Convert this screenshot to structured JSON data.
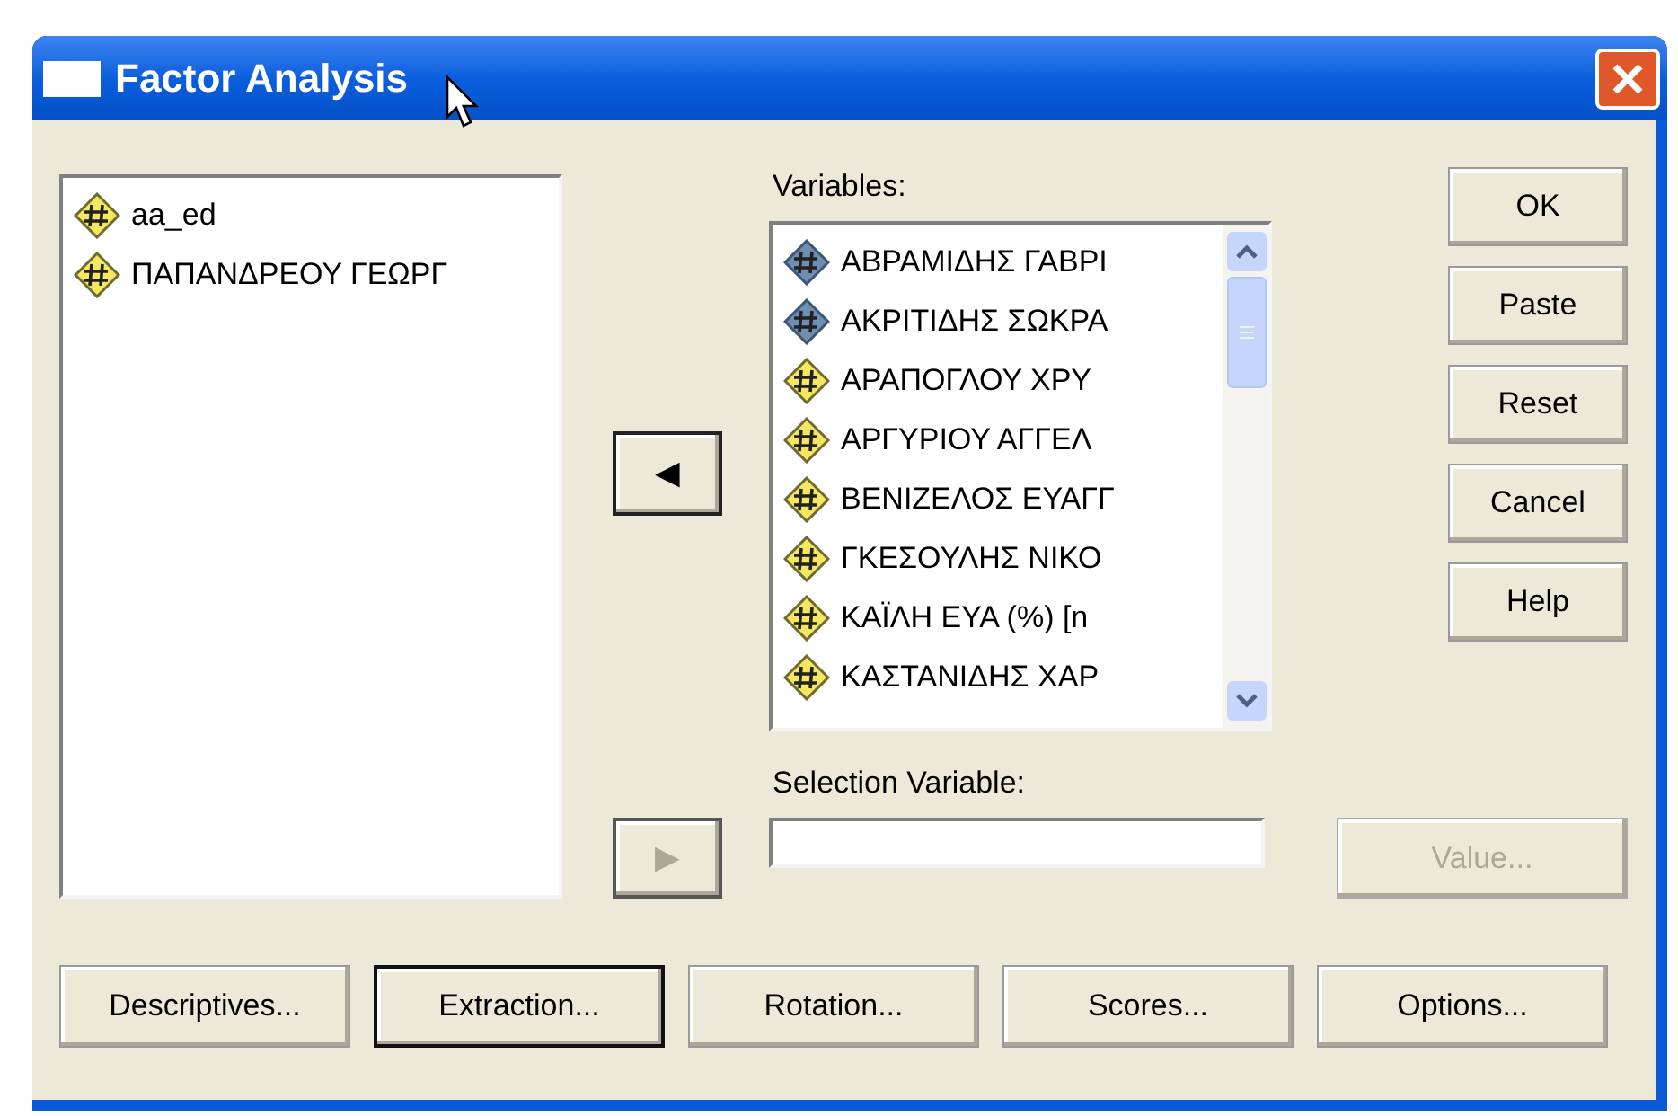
{
  "window": {
    "title": "Factor Analysis"
  },
  "source_list": {
    "items": [
      {
        "label": "aa_ed",
        "selected": false
      },
      {
        "label": "ΠΑΠΑΝΔΡΕΟΥ ΓΕΩΡΓ",
        "selected": false
      }
    ]
  },
  "move_button": {
    "label": "◀",
    "disabled": false
  },
  "variables": {
    "label": "Variables:",
    "items": [
      {
        "label": "ΑΒΡΑΜΙΔΗΣ ΓΑΒΡΙ",
        "selected": true
      },
      {
        "label": "ΑΚΡΙΤΙΔΗΣ ΣΩΚΡΑ",
        "selected": true
      },
      {
        "label": "ΑΡΑΠΟΓΛΟΥ ΧΡΥ",
        "selected": false
      },
      {
        "label": "ΑΡΓΥΡΙΟΥ ΑΓΓΕΛ",
        "selected": false
      },
      {
        "label": "ΒΕΝΙΖΕΛΟΣ ΕΥΑΓΓ",
        "selected": false
      },
      {
        "label": "ΓΚΕΣΟΥΛΗΣ ΝΙΚΟ",
        "selected": false
      },
      {
        "label": "ΚΑΪΛΗ ΕΥΑ (%) [n",
        "selected": false
      },
      {
        "label": "ΚΑΣΤΑΝΙΔΗΣ ΧΑΡ",
        "selected": false
      }
    ]
  },
  "selection_variable": {
    "label": "Selection Variable:",
    "move_button": {
      "label": "▶",
      "disabled": true
    },
    "value_button": {
      "label": "Value...",
      "disabled": true
    }
  },
  "side_buttons": [
    {
      "label": "OK"
    },
    {
      "label": "Paste"
    },
    {
      "label": "Reset"
    },
    {
      "label": "Cancel"
    },
    {
      "label": "Help"
    }
  ],
  "bottom_buttons": [
    {
      "label": "Descriptives...",
      "default": false
    },
    {
      "label": "Extraction...",
      "default": true
    },
    {
      "label": "Rotation...",
      "default": false
    },
    {
      "label": "Scores...",
      "default": false
    },
    {
      "label": "Options...",
      "default": false
    }
  ]
}
